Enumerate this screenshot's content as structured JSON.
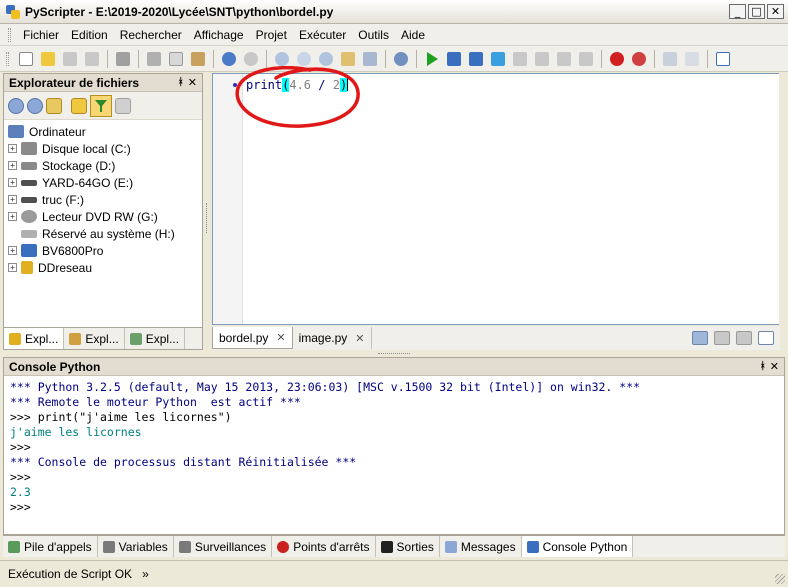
{
  "window": {
    "title": "PyScripter - E:\\2019-2020\\Lycée\\SNT\\python\\bordel.py",
    "min": "_",
    "max": "□",
    "close": "✕"
  },
  "menu": [
    {
      "label": "Fichier"
    },
    {
      "label": "Edition"
    },
    {
      "label": "Rechercher"
    },
    {
      "label": "Affichage"
    },
    {
      "label": "Projet"
    },
    {
      "label": "Exécuter"
    },
    {
      "label": "Outils"
    },
    {
      "label": "Aide"
    }
  ],
  "explorer": {
    "title": "Explorateur de fichiers",
    "pin": "ᚼ",
    "close": "✕",
    "items": [
      {
        "label": "Ordinateur",
        "expander": "",
        "color": "#5b7fb8"
      },
      {
        "label": "Disque local (C:)",
        "expander": "+",
        "color": "#8a8a8a"
      },
      {
        "label": "Stockage (D:)",
        "expander": "+",
        "color": "#8a8a8a"
      },
      {
        "label": "YARD-64GO (E:)",
        "expander": "+",
        "color": "#505050"
      },
      {
        "label": "truc (F:)",
        "expander": "+",
        "color": "#505050"
      },
      {
        "label": "Lecteur DVD RW (G:)",
        "expander": "+",
        "color": "#9a9a9a"
      },
      {
        "label": "Réservé au système (H:)",
        "expander": "",
        "color": "#9a9a9a"
      },
      {
        "label": "BV6800Pro",
        "expander": "+",
        "color": "#3a6fbf"
      },
      {
        "label": "DDreseau",
        "expander": "+",
        "color": "#e0b020"
      }
    ],
    "tabs": [
      {
        "label": "Expl..."
      },
      {
        "label": "Expl..."
      },
      {
        "label": "Expl..."
      }
    ]
  },
  "editor": {
    "code": {
      "fn": "print",
      "open": "(",
      "num1": "4.6",
      "op": " / ",
      "num2": "2",
      "close": ")"
    },
    "tabs": [
      {
        "label": "bordel.py",
        "close": "✕"
      },
      {
        "label": "image.py",
        "close": "✕"
      }
    ]
  },
  "console": {
    "title": "Console Python",
    "pin": "ᚼ",
    "close": "✕",
    "lines": [
      {
        "cls": "c-info",
        "text": "*** Python 3.2.5 (default, May 15 2013, 23:06:03) [MSC v.1500 32 bit (Intel)] on win32. ***"
      },
      {
        "cls": "c-info",
        "text": "*** Remote le moteur Python  est actif ***"
      },
      {
        "cls": "c-prompt",
        "text": ">>> print(\"j'aime les licornes\")"
      },
      {
        "cls": "c-out",
        "text": "j'aime les licornes"
      },
      {
        "cls": "c-prompt",
        "text": ">>>"
      },
      {
        "cls": "c-info",
        "text": "*** Console de processus distant Réinitialisée ***"
      },
      {
        "cls": "c-prompt",
        "text": ">>>"
      },
      {
        "cls": "c-out",
        "text": "2.3"
      },
      {
        "cls": "c-prompt",
        "text": ">>>"
      }
    ]
  },
  "bottom_tabs": [
    {
      "label": "Pile d'appels",
      "color": "#5a9a5a"
    },
    {
      "label": "Variables",
      "color": "#7a7a7a"
    },
    {
      "label": "Surveillances",
      "color": "#7a7a7a"
    },
    {
      "label": "Points d'arrêts",
      "color": "#cc2020"
    },
    {
      "label": "Sorties",
      "color": "#202020"
    },
    {
      "label": "Messages",
      "color": "#8aa7d6"
    },
    {
      "label": "Console Python",
      "color": "#3a6fbf"
    }
  ],
  "status": {
    "text": "Exécution de Script OK",
    "chevron": "»"
  }
}
